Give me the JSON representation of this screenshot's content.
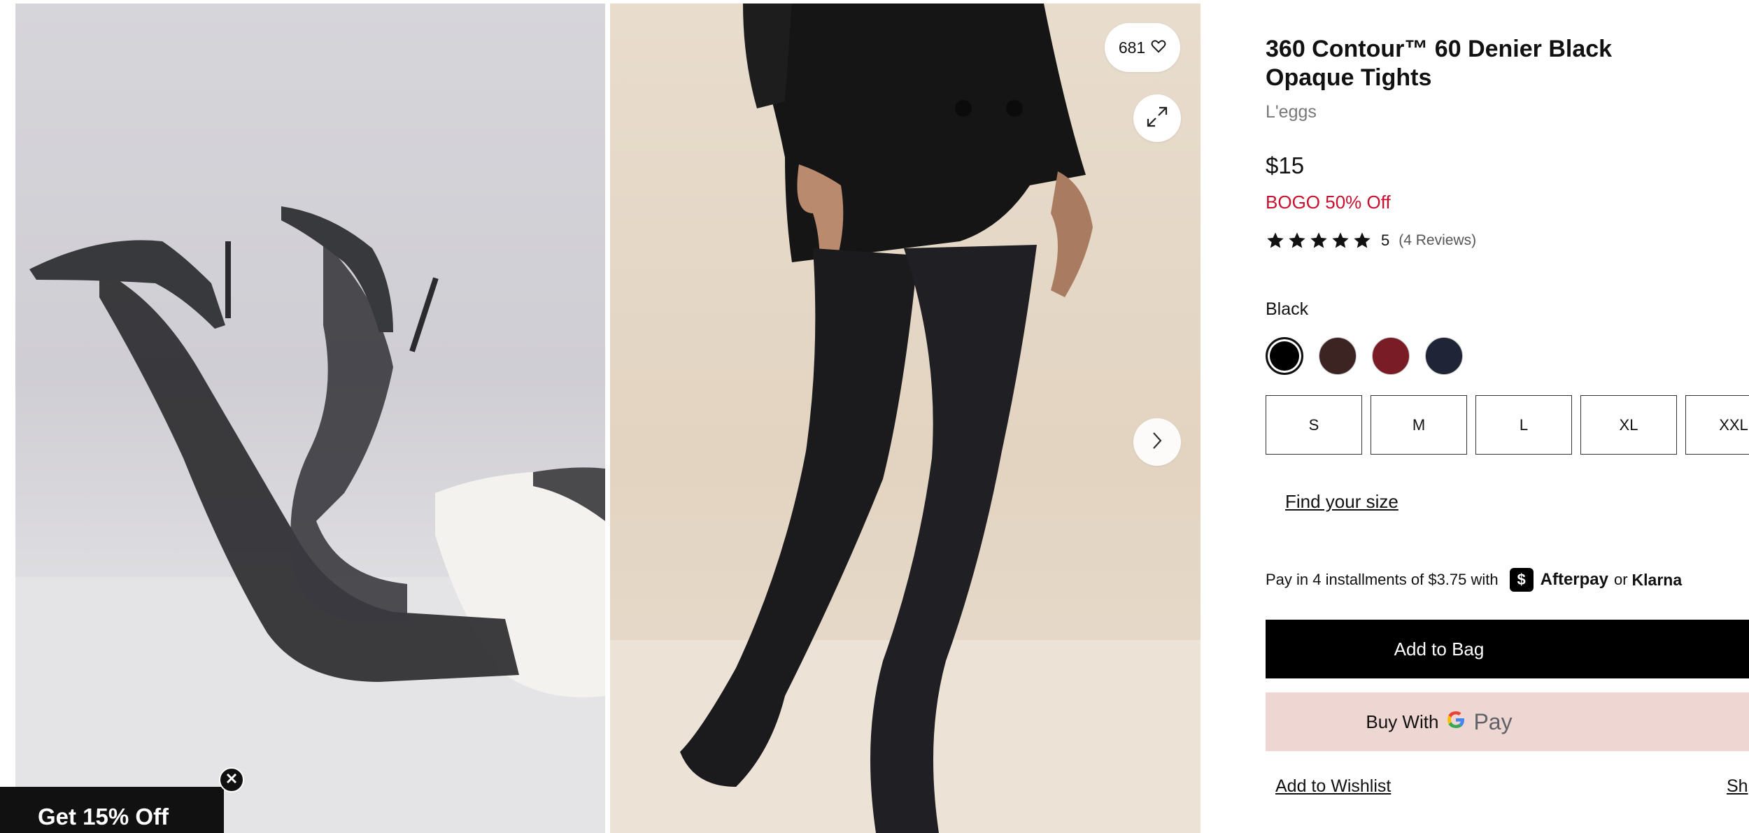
{
  "gallery": {
    "likes_count": "681",
    "images": [
      "product-photo-legs-heels",
      "product-photo-model-standing"
    ]
  },
  "promo": {
    "label": "Get 15% Off"
  },
  "product": {
    "title": "360 Contour™ 60 Denier Black Opaque Tights",
    "brand": "L'eggs",
    "price": "$15",
    "promotion": "BOGO 50% Off",
    "rating": {
      "score": "5",
      "reviews_label": "(4 Reviews)",
      "stars": 5
    },
    "color": {
      "selected_label": "Black",
      "swatches": [
        {
          "name": "black",
          "hex": "#000000"
        },
        {
          "name": "brown",
          "hex": "#3b2421"
        },
        {
          "name": "burgundy",
          "hex": "#7a1c26"
        },
        {
          "name": "navy",
          "hex": "#1f2436"
        }
      ]
    },
    "sizes": [
      "S",
      "M",
      "L",
      "XL",
      "XXL"
    ],
    "find_size_label": "Find your size",
    "installments": {
      "text": "Pay in 4 installments of $3.75 with",
      "afterpay_label": "Afterpay",
      "or_label": "or",
      "klarna_label": "Klarna"
    },
    "add_to_bag_label": "Add to Bag",
    "buy_with_label": "Buy With",
    "gpay_label": "Pay",
    "wishlist_label": "Add to Wishlist",
    "share_label": "Sh"
  },
  "colors": {
    "accent_red": "#c8102e",
    "gpay_bg": "#eed6d2"
  }
}
